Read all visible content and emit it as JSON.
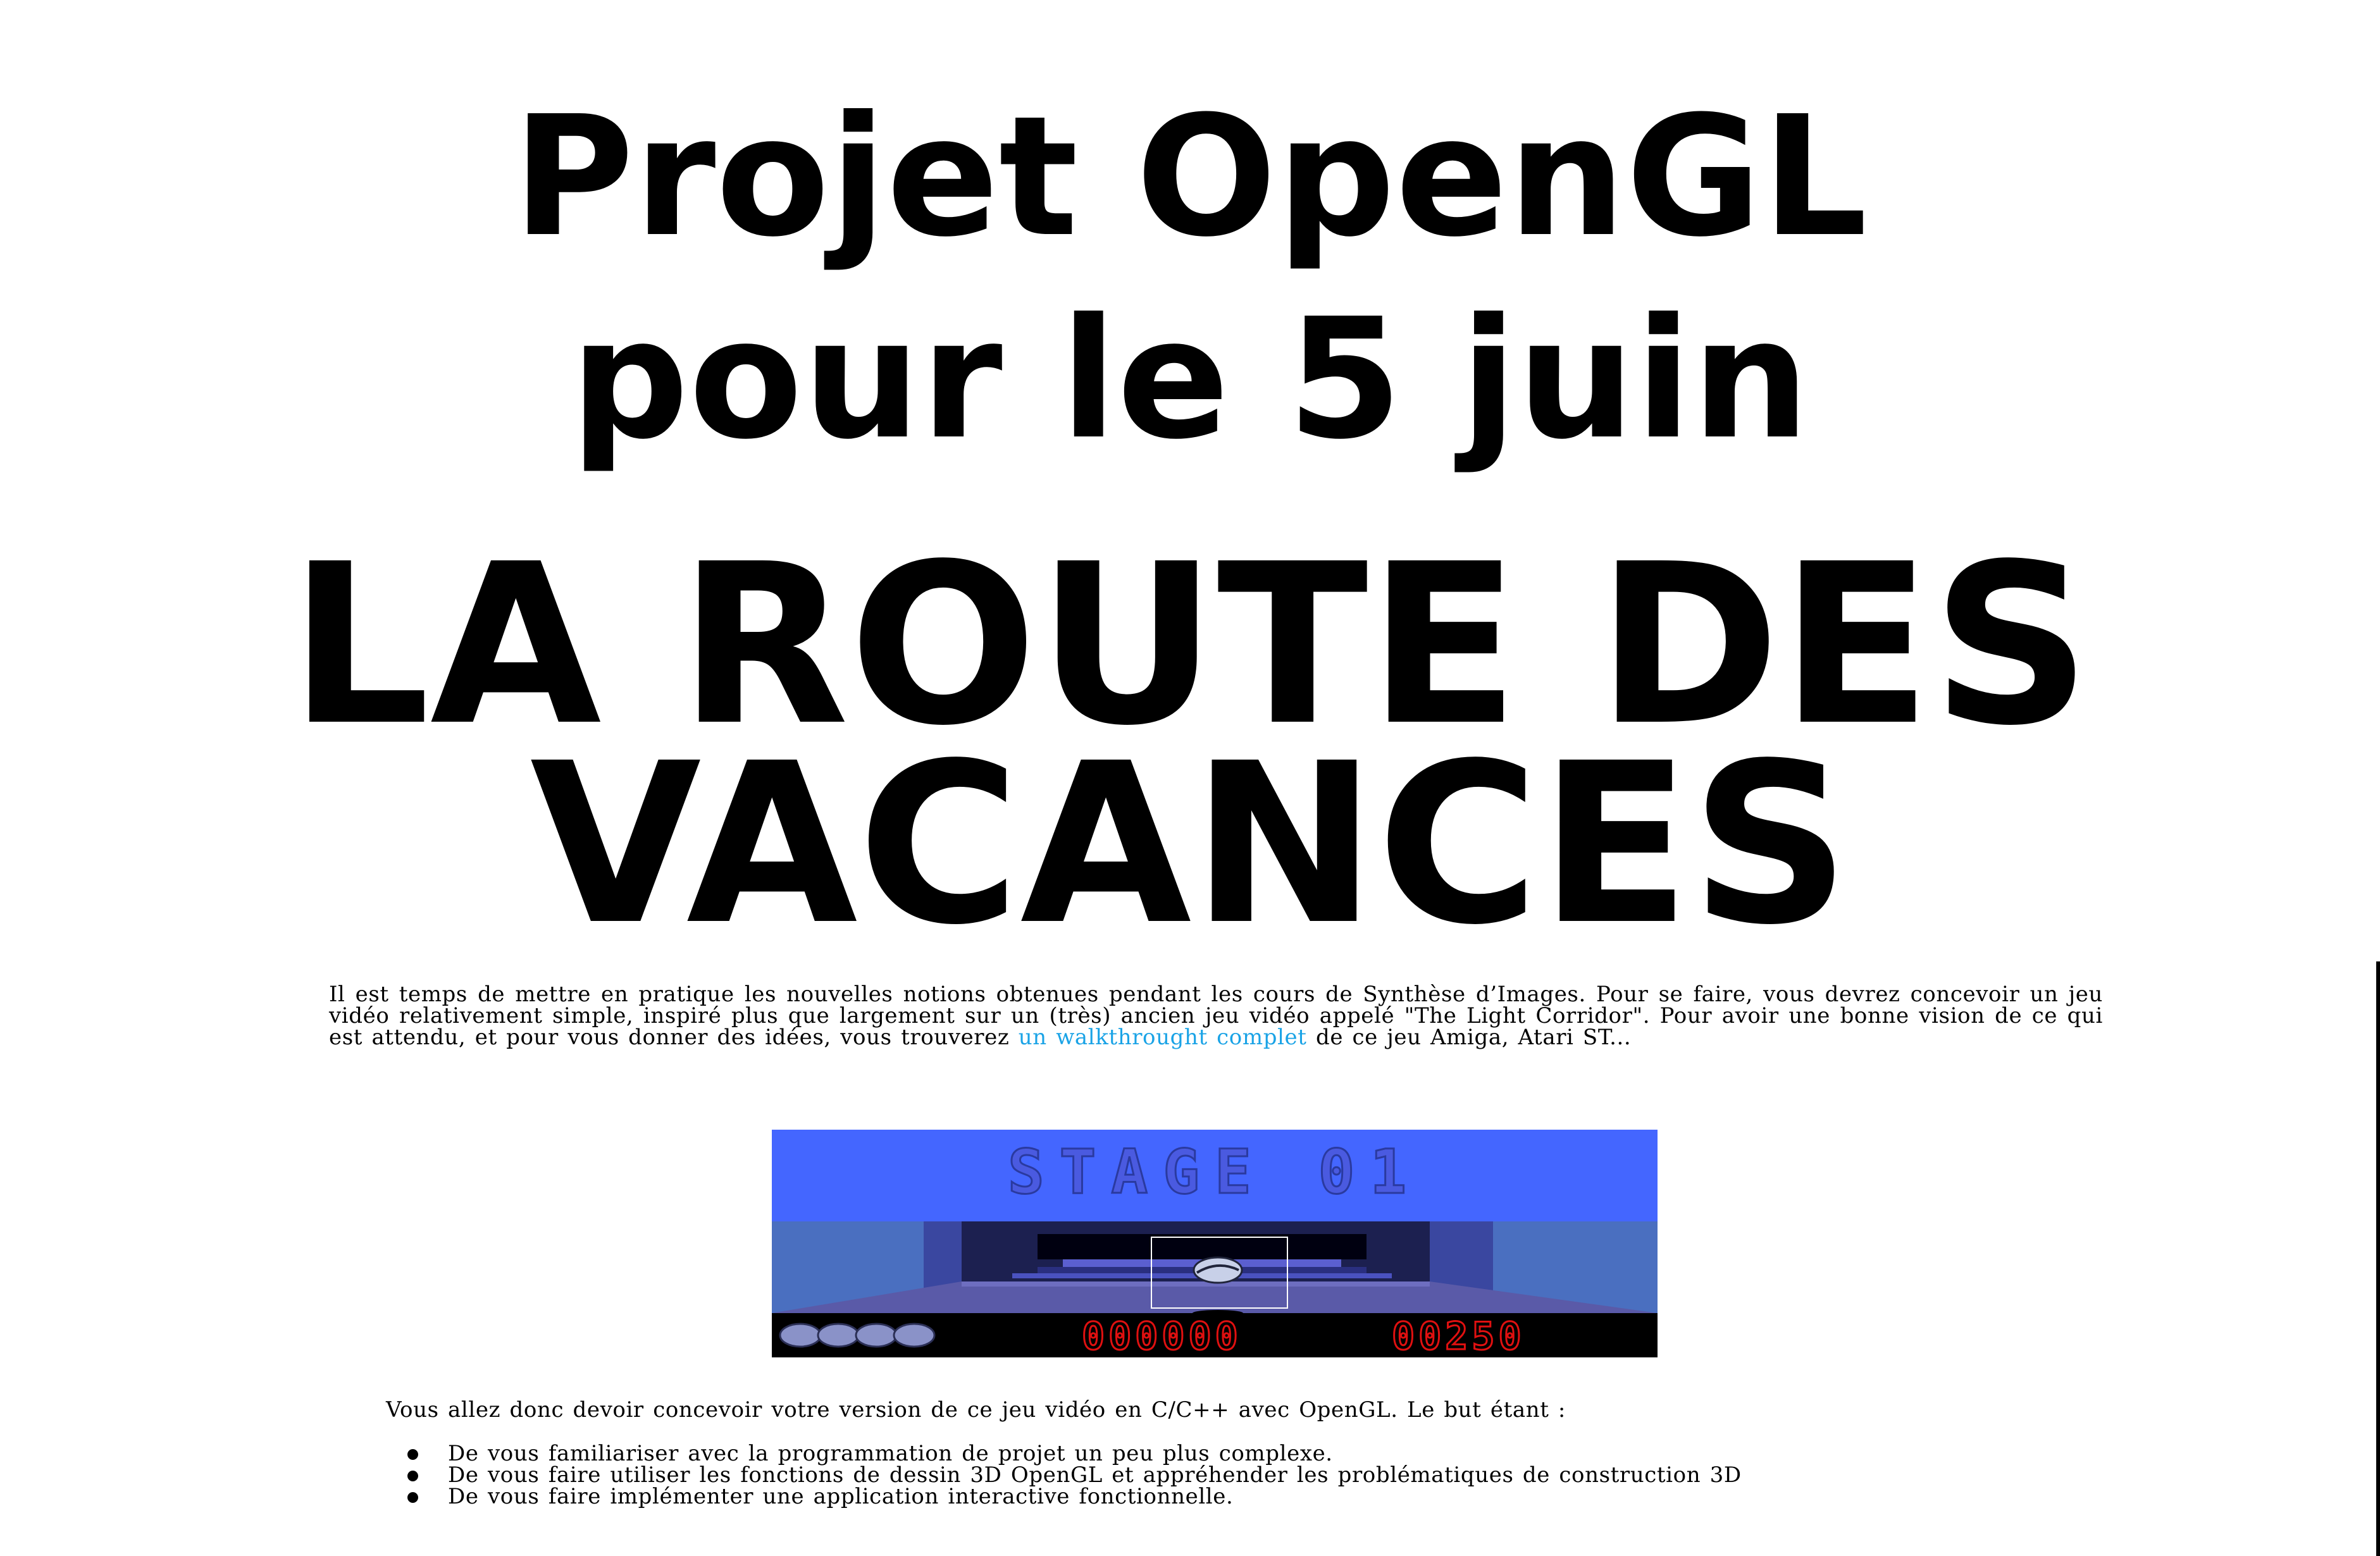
{
  "titles": {
    "line1": "Projet OpenGL",
    "line2": "pour le 5 juin",
    "line3": "LA ROUTE DES",
    "line4": "VACANCES"
  },
  "intro": {
    "text_before_link": "Il est temps de mettre en pratique les nouvelles notions obtenues pendant les cours de Synthèse d’Images. Pour se faire, vous devrez concevoir un jeu vidéo relativement simple, inspiré plus que largement sur un (très) ancien jeu vidéo appelé \"The Light Corridor\". Pour avoir une bonne vision de ce qui est attendu, et pour vous donner des idées, vous trouverez ",
    "link_text": "un walkthrought complet",
    "text_after_link": " de ce jeu Amiga, Atari ST..."
  },
  "game_screenshot": {
    "stage_text": "STAGE 01",
    "score_left": "000000",
    "score_right": "00250",
    "colors": {
      "sky": "#4466ff",
      "corridor_wall": "#4a6fc0",
      "floor": "#5a5aa8",
      "hud_background": "#000000",
      "hud_digits": "#e01010"
    }
  },
  "body": {
    "para2": "Vous allez donc devoir concevoir votre version de ce jeu vidéo en C/C++ avec OpenGL. Le but étant :",
    "bullets": [
      "De vous familiariser avec la programmation de projet un peu plus complexe.",
      "De vous faire utiliser les fonctions de dessin 3D OpenGL et appréhender les problématiques de construction 3D",
      "De vous faire implémenter une application interactive fonctionnelle."
    ]
  }
}
